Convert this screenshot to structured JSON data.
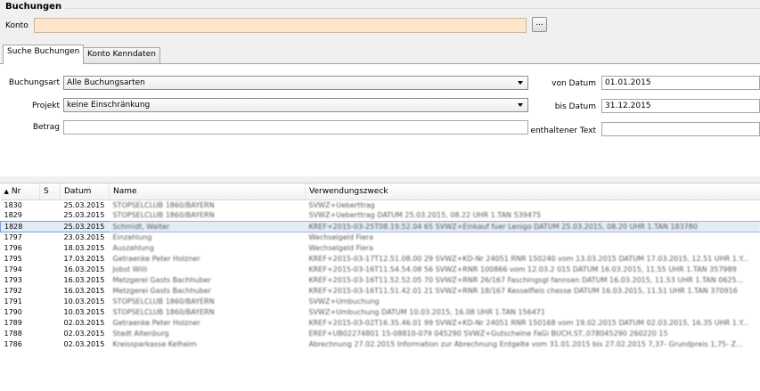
{
  "group": {
    "title": "Buchungen"
  },
  "konto": {
    "label": "Konto",
    "value": "",
    "browse_label": "..."
  },
  "tabs": [
    {
      "label": "Suche Buchungen",
      "active": true
    },
    {
      "label": "Konto Kenndaten",
      "active": false
    }
  ],
  "search": {
    "buchungsart_label": "Buchungsart",
    "buchungsart_value": "Alle Buchungsarten",
    "projekt_label": "Projekt",
    "projekt_value": "keine Einschränkung",
    "betrag_label": "Betrag",
    "betrag_value": "",
    "von_label": "von Datum",
    "von_value": "01.01.2015",
    "bis_label": "bis Datum",
    "bis_value": "31.12.2015",
    "text_label": "enthaltener Text",
    "text_value": ""
  },
  "table": {
    "sort_icon": "▲",
    "columns": [
      "Nr",
      "S",
      "Datum",
      "Name",
      "Verwendungszweck"
    ],
    "selected_row": 2,
    "rows": [
      [
        "1830",
        "",
        "25.03.2015",
        "STOPSELCLUB 1860/BAYERN",
        "SVWZ+Ueberttrag"
      ],
      [
        "1829",
        "",
        "25.03.2015",
        "STOPSELCLUB 1860/BAYERN",
        "SVWZ+Ueberttrag DATUM 25.03.2015, 08.22 UHR 1.TAN 539475"
      ],
      [
        "1828",
        "",
        "25.03.2015",
        "Schmidt, Walter",
        "KREF+2015-03-25T08.19.52.04 65 SVWZ+Einkauf fuer Lenigo DATUM 25.03.2015, 08.20 UHR 1.TAN 183780"
      ],
      [
        "1797",
        "",
        "23.03.2015",
        "Einzahlung",
        "Wechselgeld Fiera"
      ],
      [
        "1796",
        "",
        "18.03.2015",
        "Auszahlung",
        "Wechselgeld Fiera"
      ],
      [
        "1795",
        "",
        "17.03.2015",
        "Getraenke Peter Holzner",
        "KREF+2015-03-17T12.51.08.00 29 SVWZ+KD-Nr 24051 RNR 150240 vom 13.03.2015 DATUM 17.03.2015, 12.51 UHR 1.Y..."
      ],
      [
        "1794",
        "",
        "16.03.2015",
        "Jobst Willi",
        "KREF+2015-03-16T11.54.54.08 56 SVWZ+RNR 100866 vom 12.03.2 015 DATUM 16.03.2015, 11.55 UHR 1.TAN 357989"
      ],
      [
        "1793",
        "",
        "16.03.2015",
        "Metzgerei Gasts Bachhuber",
        "KREF+2015-03-16T11.52.52.05 70 SVWZ+RNR 26/167 Faschingsgl fannsen DATUM 16.03.2015, 11.53 UHR 1.TAN 0625..."
      ],
      [
        "1792",
        "",
        "16.03.2015",
        "Metzgerei Gasts Bachhuber",
        "KREF+2015-03-16T11.51.42.01 21 SVWZ+RNR 18/167 Kesselfleis chesse DATUM 16.03.2015, 11.51 UHR 1.TAN 370916"
      ],
      [
        "1791",
        "",
        "10.03.2015",
        "STOPSELCLUB 1860/BAYERN",
        "SVWZ+Umbuchung"
      ],
      [
        "1790",
        "",
        "10.03.2015",
        "STOPSELCLUB 1860/BAYERN",
        "SVWZ+Umbuchung DATUM 10.03.2015, 16.08 UHR 1.TAN 156471"
      ],
      [
        "1789",
        "",
        "02.03.2015",
        "Getraenke Peter Holzner",
        "KREF+2015-03-02T16.35.46.01 99 SVWZ+KD-Nr 24051 RNR 150168 vom 19.02.2015 DATUM 02.03.2015, 16.35 UHR 1.Y..."
      ],
      [
        "1788",
        "",
        "02.03.2015",
        "Stadt Altenburg",
        "EREF+UB02274801 15-08810-079 045290 SVWZ+Gutscheine FaGi BUCH.ST..078045290 260220 15"
      ],
      [
        "1786",
        "",
        "02.03.2015",
        "Kreissparkasse Kelheim",
        "Abrechnung 27.02.2015 Information zur Abrechnung Entgelte vom 31.01.2015 bis 27.02.2015 7,37- Grundpreis 1,75- Z..."
      ]
    ]
  }
}
